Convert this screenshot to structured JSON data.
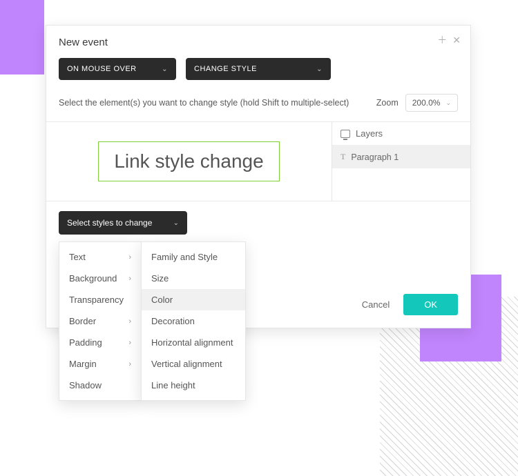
{
  "dialog": {
    "title": "New event",
    "trigger_label": "ON MOUSE OVER",
    "action_label": "CHANGE STYLE",
    "instruction": "Select the element(s) you want to change style (hold Shift to multiple-select)",
    "zoom_label": "Zoom",
    "zoom_value": "200.0%",
    "canvas_text": "Link style change",
    "layers_header": "Layers",
    "layer_item": "Paragraph 1",
    "select_styles_label": "Select styles to change",
    "cancel": "Cancel",
    "ok": "OK"
  },
  "style_menu": {
    "primary": [
      {
        "label": "Text",
        "has_submenu": true
      },
      {
        "label": "Background",
        "has_submenu": true
      },
      {
        "label": "Transparency",
        "has_submenu": false
      },
      {
        "label": "Border",
        "has_submenu": true
      },
      {
        "label": "Padding",
        "has_submenu": true
      },
      {
        "label": "Margin",
        "has_submenu": true
      },
      {
        "label": "Shadow",
        "has_submenu": false
      }
    ],
    "submenu": [
      {
        "label": "Family and Style"
      },
      {
        "label": "Size"
      },
      {
        "label": "Color"
      },
      {
        "label": "Decoration"
      },
      {
        "label": "Horizontal alignment"
      },
      {
        "label": "Vertical alignment"
      },
      {
        "label": "Line height"
      }
    ],
    "submenu_selected_index": 2
  }
}
